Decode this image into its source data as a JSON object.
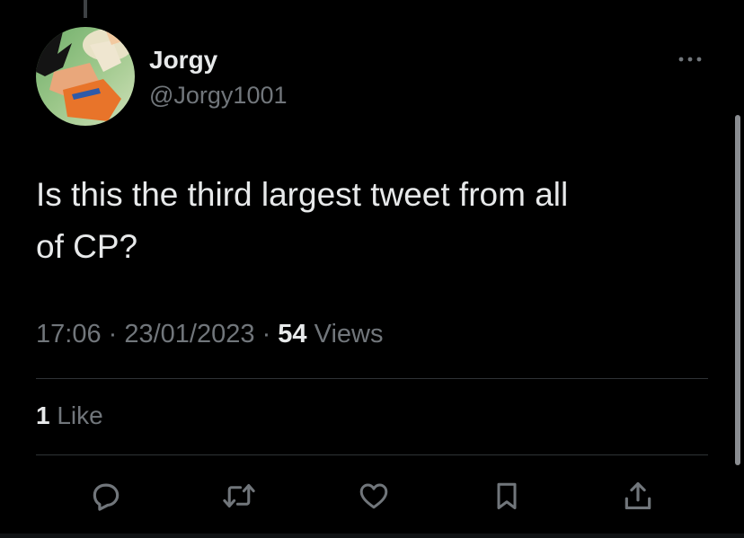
{
  "author": {
    "name": "Jorgy",
    "handle": "@Jorgy1001"
  },
  "tweet": {
    "text_line1": "Is this the third largest tweet from all",
    "text_line2": "of CP?",
    "time": "17:06",
    "sep1": " · ",
    "date": "23/01/2023",
    "sep2": " · ",
    "views_count": "54",
    "views_label": " Views"
  },
  "stats": {
    "likes_count": "1",
    "likes_label": " Like"
  },
  "actions": {
    "icons": [
      "reply-icon",
      "retweet-icon",
      "like-icon",
      "bookmark-icon",
      "share-icon"
    ]
  },
  "colors": {
    "background": "#000000",
    "primary_text": "#e7e9ea",
    "secondary_text": "#71767b",
    "divider": "#2f3336"
  }
}
